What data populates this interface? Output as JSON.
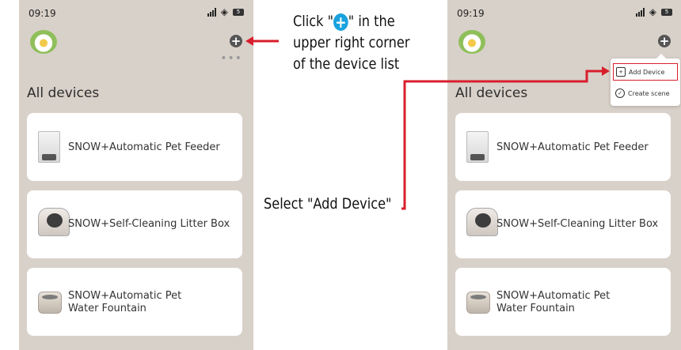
{
  "status_bar": {
    "time": "09:19",
    "battery": "5"
  },
  "section_title": "All devices",
  "devices": [
    {
      "brand": "SNOW",
      "sup": "+",
      "name": "Automatic Pet Feeder"
    },
    {
      "brand": "SNOW",
      "sup": "+",
      "name": "Self-Cleaning Litter Box"
    },
    {
      "brand": "SNOW",
      "sup": "+",
      "name_line1": "Automatic Pet",
      "name_line2": "Water Fountain"
    }
  ],
  "menu": {
    "add_device": "Add Device",
    "create_scene": "Create scene"
  },
  "more_dots": "•••",
  "instructions": {
    "step1_prefix": "Click \"",
    "step1_suffix": "\" in the",
    "step1_line2": "upper right corner",
    "step1_line3": "of the device list",
    "step2": "Select \"Add Device\""
  },
  "colors": {
    "accent_red": "#d81e2c",
    "accent_blue": "#19a2de",
    "background": "#d8d1c9"
  },
  "icons": [
    "plus-circle-icon",
    "signal-icon",
    "wifi-icon",
    "battery-icon",
    "more-dots-icon",
    "add-device-icon",
    "create-scene-icon"
  ]
}
